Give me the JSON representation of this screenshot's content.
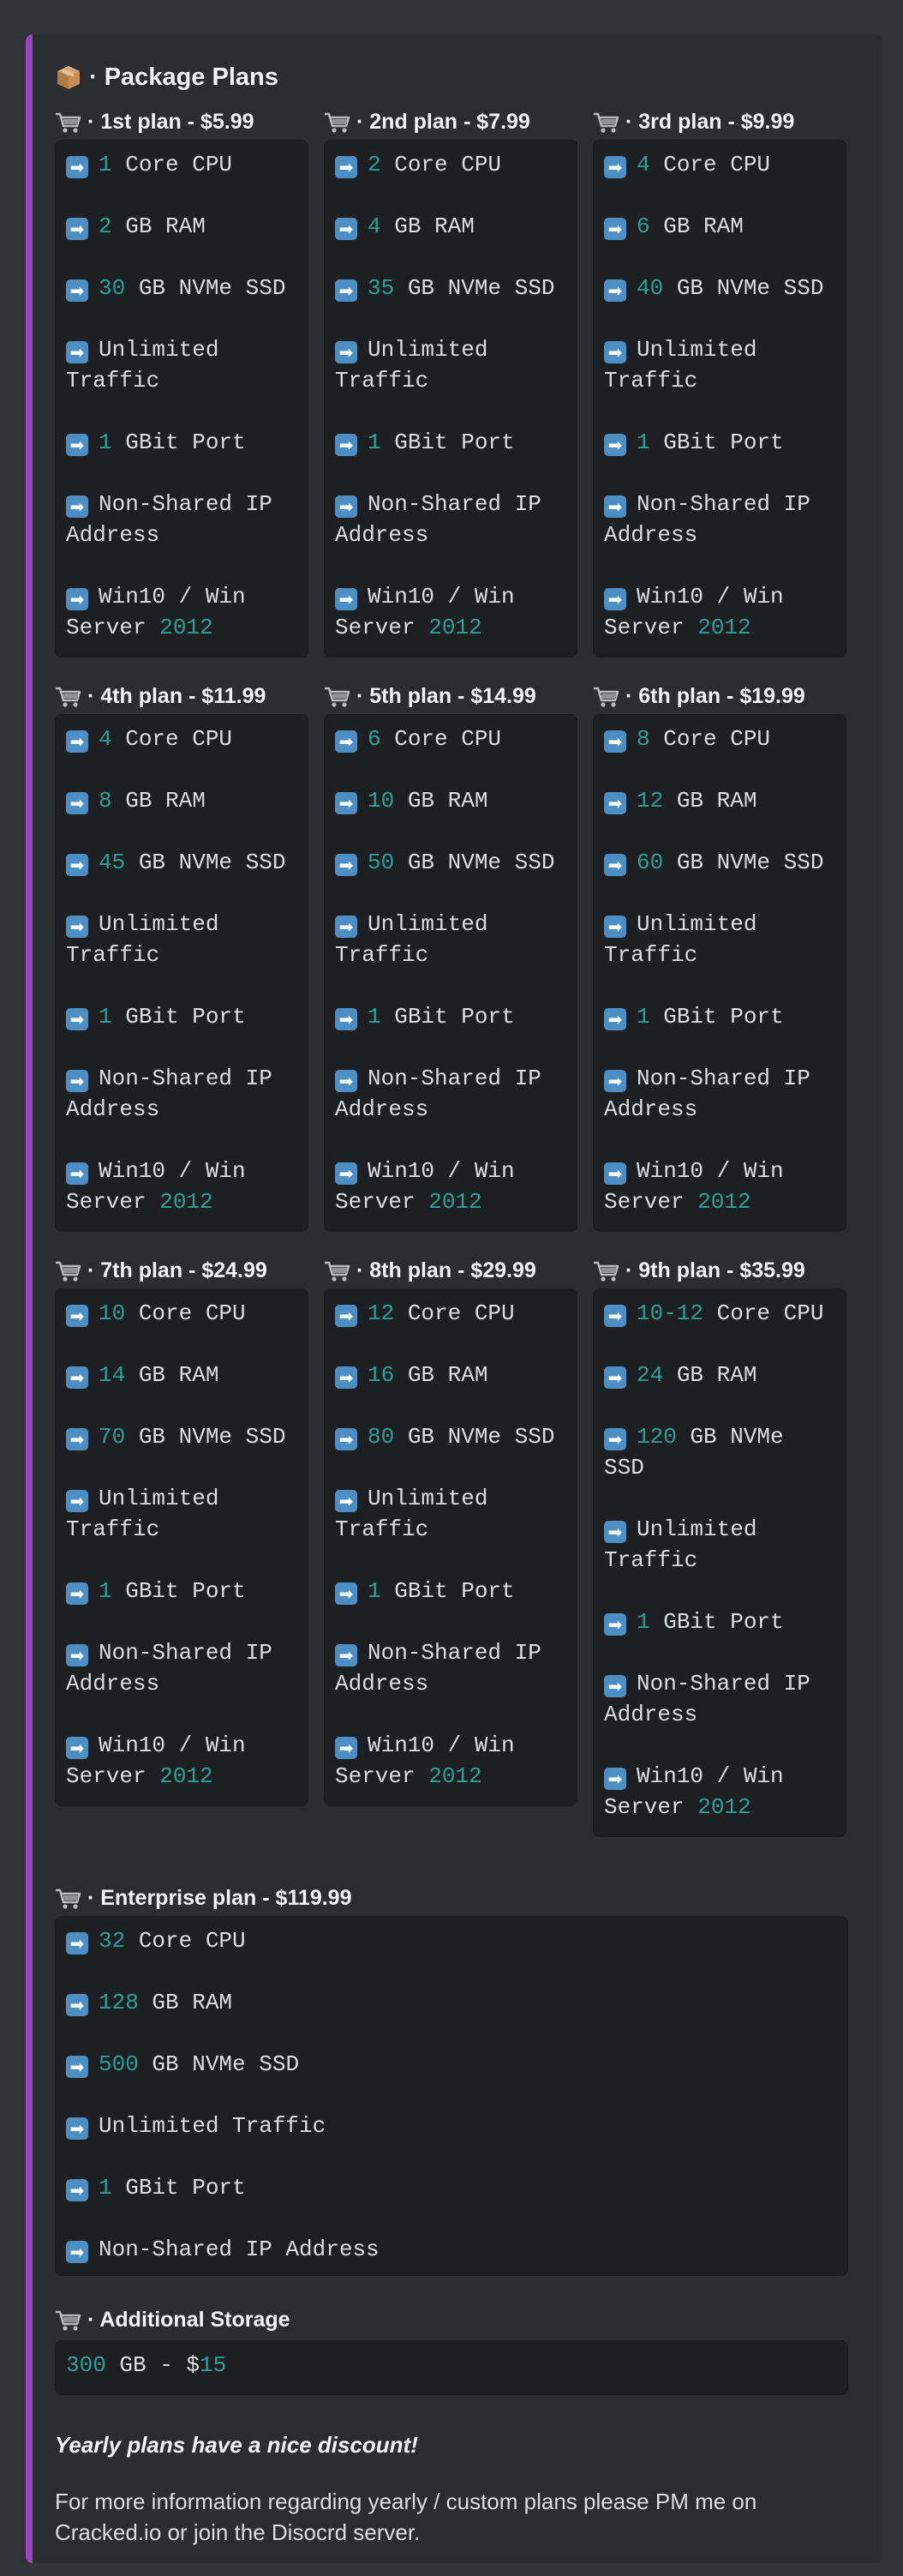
{
  "title": "· Package Plans",
  "plans": [
    {
      "name": "· 1st plan - $5.99",
      "cpu": "1",
      "ram": "2",
      "ssd": "30",
      "year": "2012"
    },
    {
      "name": "· 2nd plan - $7.99",
      "cpu": "2",
      "ram": "4",
      "ssd": "35",
      "year": "2012"
    },
    {
      "name": "· 3rd plan - $9.99",
      "cpu": "4",
      "ram": "6",
      "ssd": "40",
      "year": "2012"
    },
    {
      "name": "· 4th plan - $11.99",
      "cpu": "4",
      "ram": "8",
      "ssd": "45",
      "year": "2012"
    },
    {
      "name": "· 5th plan - $14.99",
      "cpu": "6",
      "ram": "10",
      "ssd": "50",
      "year": "2012"
    },
    {
      "name": "· 6th plan - $19.99",
      "cpu": "8",
      "ram": "12",
      "ssd": "60",
      "year": "2012"
    },
    {
      "name": "· 7th plan - $24.99",
      "cpu": "10",
      "ram": "14",
      "ssd": "70",
      "year": "2012"
    },
    {
      "name": "· 8th plan - $29.99",
      "cpu": "12",
      "ram": "16",
      "ssd": "80",
      "year": "2012"
    },
    {
      "name": "· 9th plan - $35.99",
      "cpu": "10-12",
      "ram": "24",
      "ssd": "120",
      "year": "2012"
    }
  ],
  "labels": {
    "core_cpu": " Core CPU",
    "gb_ram": " GB RAM",
    "gb_nvme_ssd": " GB NVMe SSD",
    "unlimited": "Unlimited",
    "traffic": "Traffic",
    "unlimited_traffic": "Unlimited Traffic",
    "gbit_port": " GBit Port",
    "port_num": "1",
    "non_shared": "Non-Shared IP",
    "address": "Address",
    "non_shared_full": "Non-Shared IP Address",
    "win": "Win10 / Win",
    "server": "Server ",
    "nvme_short": " GB NVMe",
    "ssd_word": "SSD"
  },
  "enterprise": {
    "name": "· Enterprise plan -  $119.99",
    "cpu": "32",
    "ram": "128",
    "ssd": "500"
  },
  "storage": {
    "name": "· Additional Storage",
    "amount": "300",
    "text": " GB - $",
    "price": "15"
  },
  "footer": {
    "bold": "Yearly plans have a nice discount!",
    "text": "For more information regarding yearly / custom plans please PM me on Cracked.io or join the Disocrd server."
  },
  "icons": {
    "package": "package-icon",
    "cart": "shopping-cart-icon",
    "arrow": "arrow-right-icon"
  },
  "colors": {
    "accent_bar": "#9b45c0",
    "number": "#2aa198",
    "arrow_bg": "#4d8ec4"
  }
}
